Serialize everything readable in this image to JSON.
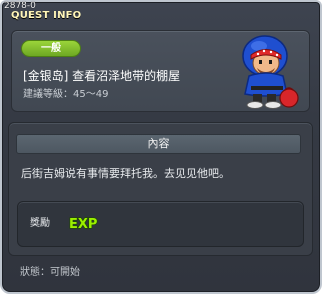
{
  "window": {
    "quest_id": "2878-0",
    "title": "QUEST INFO"
  },
  "quest": {
    "category": "一般",
    "title": "[金银岛] 查看沼泽地带的棚屋",
    "level_range": "建議等級：45～49",
    "npc_portrait_icon": "npc-portrait-icon"
  },
  "content": {
    "header": "內容",
    "description": "后街吉姆说有事情要拜托我。去见见他吧。"
  },
  "reward": {
    "label": "獎勵",
    "icon": "exp-icon",
    "icon_text": "EXP"
  },
  "status": "狀態：可開始",
  "colors": {
    "window_bg": "#353a44",
    "badge_green": "#7fbe2c",
    "title_yellow": "#fff5b8",
    "exp_green": "#9cf000"
  }
}
